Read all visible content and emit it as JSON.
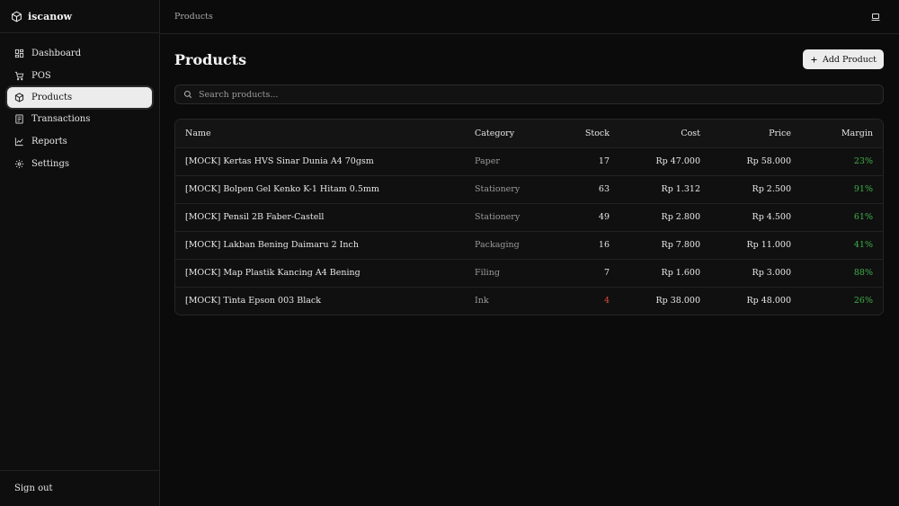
{
  "app": {
    "name": "iscanow"
  },
  "sidebar": {
    "items": [
      {
        "label": "Dashboard",
        "icon": "dashboard-icon"
      },
      {
        "label": "POS",
        "icon": "cart-icon"
      },
      {
        "label": "Products",
        "icon": "package-icon",
        "active": true
      },
      {
        "label": "Transactions",
        "icon": "receipt-icon"
      },
      {
        "label": "Reports",
        "icon": "chart-icon"
      },
      {
        "label": "Settings",
        "icon": "gear-icon"
      }
    ],
    "sign_out": "Sign out"
  },
  "topbar": {
    "breadcrumb": "Products",
    "device_icon": "laptop-icon"
  },
  "page": {
    "title": "Products",
    "add_button": "Add Product",
    "search_placeholder": "Search products..."
  },
  "table": {
    "headers": {
      "name": "Name",
      "category": "Category",
      "stock": "Stock",
      "cost": "Cost",
      "price": "Price",
      "margin": "Margin"
    },
    "rows": [
      {
        "name": "[MOCK] Kertas HVS Sinar Dunia A4 70gsm",
        "category": "Paper",
        "stock": "17",
        "cost": "Rp 47.000",
        "price": "Rp 58.000",
        "margin": "23%"
      },
      {
        "name": "[MOCK] Bolpen Gel Kenko K-1 Hitam 0.5mm",
        "category": "Stationery",
        "stock": "63",
        "cost": "Rp 1.312",
        "price": "Rp 2.500",
        "margin": "91%"
      },
      {
        "name": "[MOCK] Pensil 2B Faber-Castell",
        "category": "Stationery",
        "stock": "49",
        "cost": "Rp 2.800",
        "price": "Rp 4.500",
        "margin": "61%"
      },
      {
        "name": "[MOCK] Lakban Bening Daimaru 2 Inch",
        "category": "Packaging",
        "stock": "16",
        "cost": "Rp 7.800",
        "price": "Rp 11.000",
        "margin": "41%"
      },
      {
        "name": "[MOCK] Map Plastik Kancing A4 Bening",
        "category": "Filing",
        "stock": "7",
        "cost": "Rp 1.600",
        "price": "Rp 3.000",
        "margin": "88%"
      },
      {
        "name": "[MOCK] Tinta Epson 003 Black",
        "category": "Ink",
        "stock": "4",
        "cost": "Rp 38.000",
        "price": "Rp 48.000",
        "margin": "26%"
      }
    ]
  },
  "colors": {
    "accent_green": "#3fb04a",
    "low_stock_red": "#e04a3a",
    "active_bg": "#ececec"
  }
}
